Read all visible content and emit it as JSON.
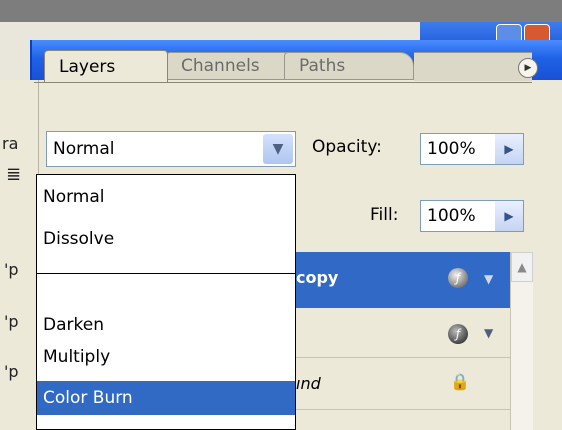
{
  "panel": {
    "tabs": [
      "Layers",
      "Channels",
      "Paths"
    ],
    "blend_mode": "Normal",
    "opacity_label": "Opacity:",
    "opacity_value": "100%",
    "fill_label": "Fill:",
    "fill_value": "100%"
  },
  "dropdown": {
    "items": [
      "Normal",
      "Dissolve",
      "Darken",
      "Multiply",
      "Color Burn"
    ]
  },
  "layers": {
    "selected_name": "copy",
    "third_name": "ınd"
  },
  "left_strip": [
    "ra",
    "'p",
    "'p",
    "'p"
  ],
  "icons": {
    "fx": "fx-icon",
    "lock": "lock-icon",
    "scroll_up": "scroll-up-icon",
    "panel_menu": "panel-menu-icon"
  },
  "colors": {
    "title_blue": "#1f62e6",
    "selection_blue": "#316ac5",
    "close_red": "#c93c17"
  }
}
